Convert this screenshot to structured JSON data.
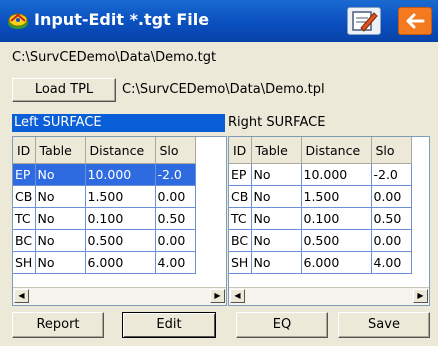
{
  "window": {
    "title": "Input-Edit *.tgt File",
    "colors": {
      "titlebar": "#0a4fbf",
      "selection": "#2f6be0",
      "back_button": "#f47a1f"
    }
  },
  "file_path": "C:\\SurvCEDemo\\Data\\Demo.tgt",
  "template": {
    "button_label": "Load TPL",
    "path": "C:\\SurvCEDemo\\Data\\Demo.tpl"
  },
  "left_surface": {
    "title": "Left SURFACE",
    "columns": [
      "ID",
      "Table",
      "Distance",
      "Slo"
    ],
    "rows": [
      [
        "EP",
        "No",
        "10.000",
        "-2.0"
      ],
      [
        "CB",
        "No",
        "1.500",
        "0.00"
      ],
      [
        "TC",
        "No",
        "0.100",
        "0.50"
      ],
      [
        "BC",
        "No",
        "0.500",
        "0.00"
      ],
      [
        "SH",
        "No",
        "6.000",
        "4.00"
      ]
    ]
  },
  "right_surface": {
    "title": "Right SURFACE",
    "columns": [
      "ID",
      "Table",
      "Distance",
      "Slo"
    ],
    "rows": [
      [
        "EP",
        "No",
        "10.000",
        "-2.0"
      ],
      [
        "CB",
        "No",
        "1.500",
        "0.00"
      ],
      [
        "TC",
        "No",
        "0.100",
        "0.50"
      ],
      [
        "BC",
        "No",
        "0.500",
        "0.00"
      ],
      [
        "SH",
        "No",
        "6.000",
        "4.00"
      ]
    ]
  },
  "buttons": {
    "report": "Report",
    "edit": "Edit",
    "eq": "EQ",
    "save": "Save"
  },
  "icons": {
    "app": "survey-app-icon",
    "edit_mode": "notepad-pencil-icon",
    "back": "back-arrow-icon"
  }
}
